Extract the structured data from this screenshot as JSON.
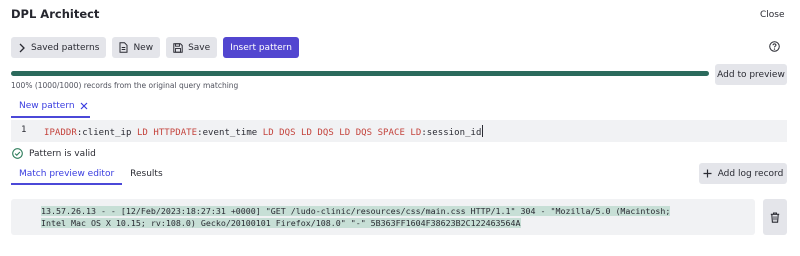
{
  "window": {
    "title": "DPL Architect",
    "close_label": "Close"
  },
  "toolbar": {
    "saved_patterns": "Saved patterns",
    "new": "New",
    "save": "Save",
    "insert_pattern": "Insert pattern"
  },
  "progress": {
    "percent": 100,
    "records_text": "100% (1000/1000) records from the original query matching",
    "add_to_preview": "Add to preview"
  },
  "pattern_tab": {
    "label": "New pattern"
  },
  "editor": {
    "line_number": "1",
    "tokens": [
      {
        "text": "IPADDR",
        "kind": "kw"
      },
      {
        "text": ":client_ip ",
        "kind": "tx"
      },
      {
        "text": "LD",
        "kind": "kw"
      },
      {
        "text": " ",
        "kind": "tx"
      },
      {
        "text": "HTTPDATE",
        "kind": "kw"
      },
      {
        "text": ":event_time ",
        "kind": "tx"
      },
      {
        "text": "LD DQS LD DQS LD DQS SPACE LD",
        "kind": "kw"
      },
      {
        "text": ":session_id",
        "kind": "tx"
      }
    ]
  },
  "validation": {
    "message": "Pattern is valid",
    "color": "#2e7d5b"
  },
  "lower_tabs": {
    "match_preview": "Match preview editor",
    "results": "Results",
    "add_log_record": "Add log record"
  },
  "log_record": {
    "line1": "13.57.26.13 - - [12/Feb/2023:18:27:31 +0000] \"GET /ludo-clinic/resources/css/main.css HTTP/1.1\" 304 - \"Mozilla/5.0 (Macintosh;",
    "line2": "Intel Mac OS X 10.15; rv:108.0) Gecko/20100101 Firefox/108.0\" \"-\" 5B363FF1604F38623B2C122463564A"
  },
  "colors": {
    "accent": "#5246d0",
    "progress": "#2b6a5c",
    "keyword": "#c4433c",
    "highlight": "#c7dfd6"
  }
}
